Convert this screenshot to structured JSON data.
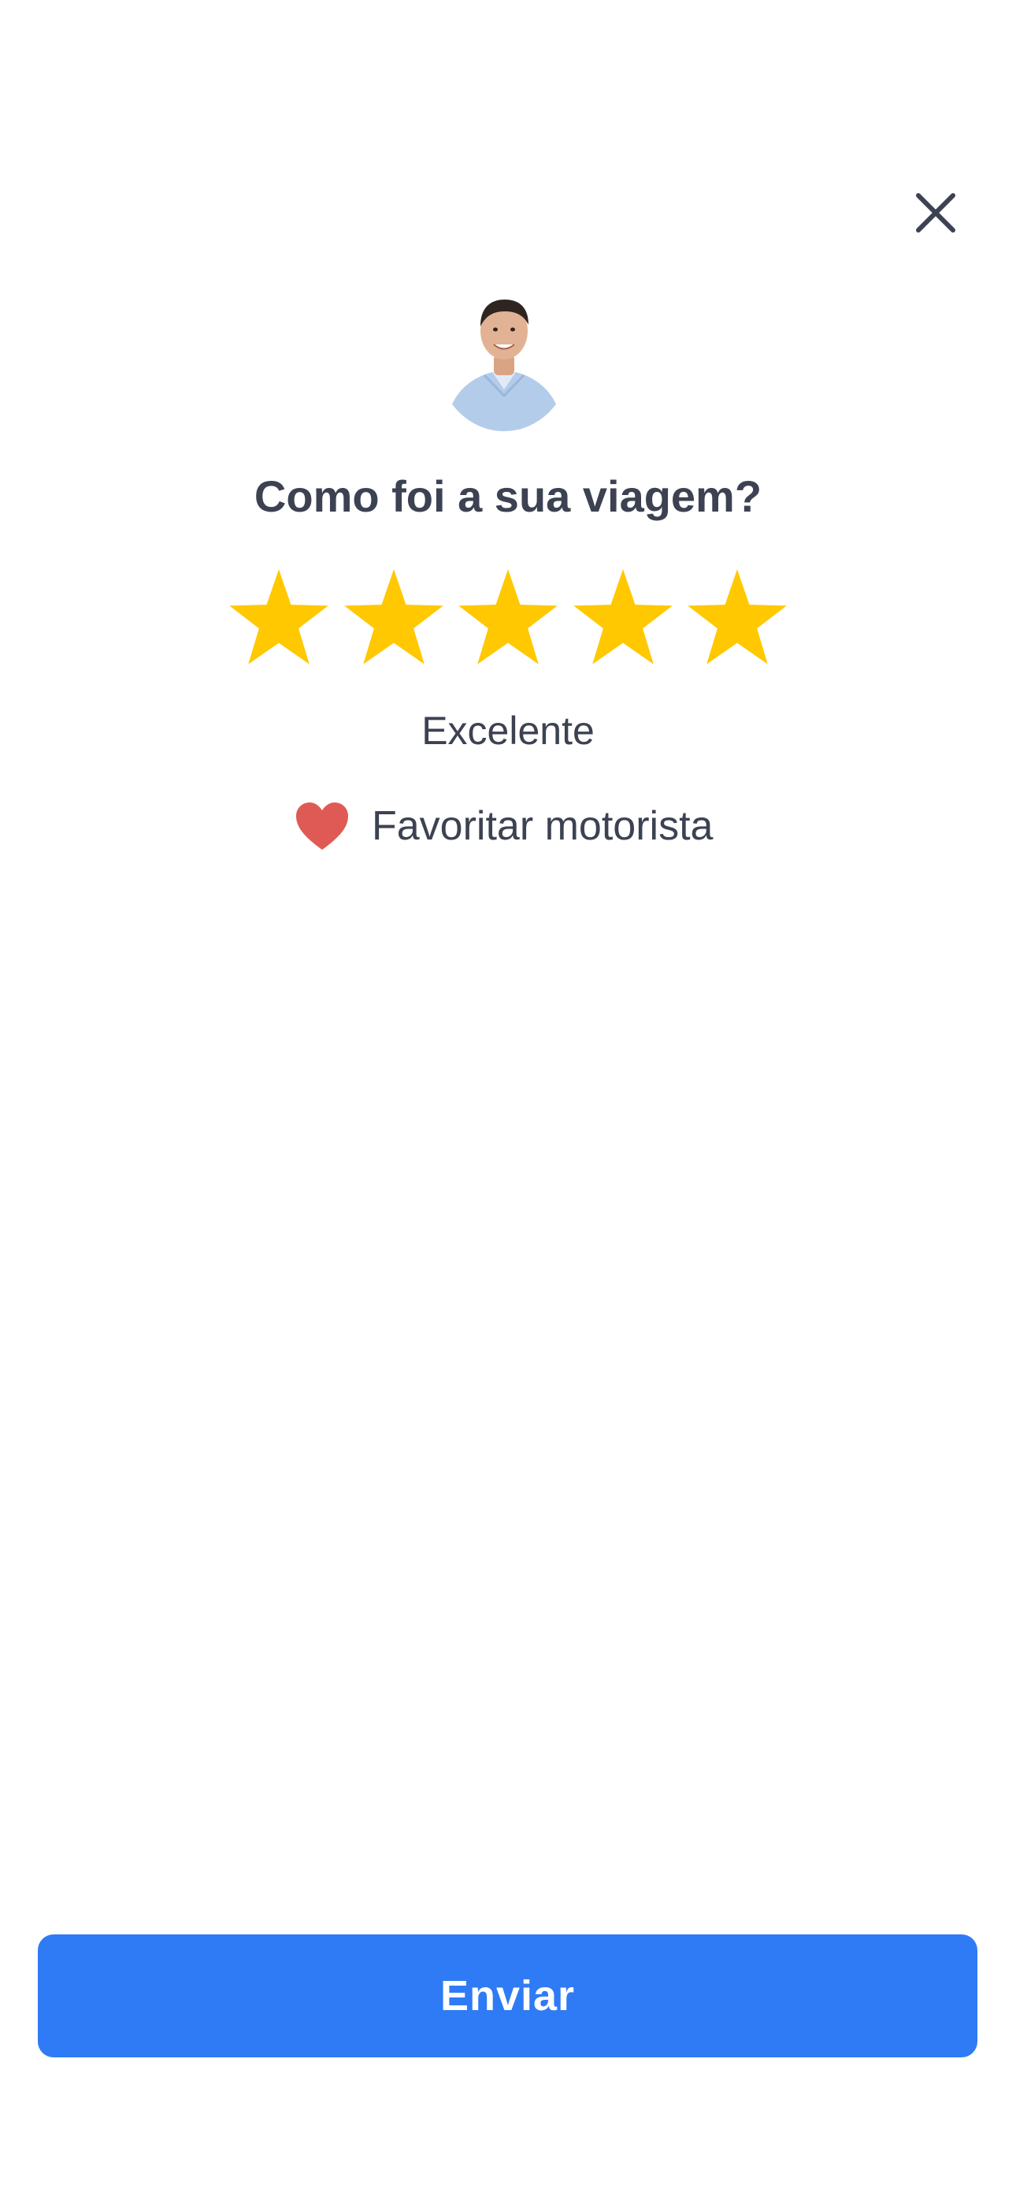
{
  "header": {
    "close_icon": "close-icon"
  },
  "driver": {
    "avatar_icon": "driver-avatar"
  },
  "rating": {
    "question": "Como foi a sua viagem?",
    "stars_selected": 5,
    "stars_total": 5,
    "star_color": "#ffc800",
    "label": "Excelente"
  },
  "favorite": {
    "icon": "heart-icon",
    "icon_color": "#e05a55",
    "label": "Favoritar motorista"
  },
  "submit": {
    "label": "Enviar",
    "color": "#2f7bf5"
  }
}
